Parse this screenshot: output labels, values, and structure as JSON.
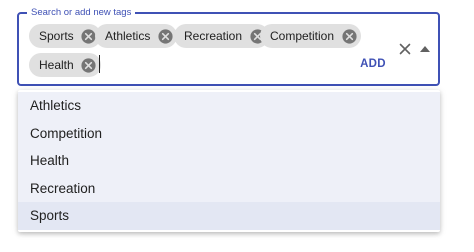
{
  "field": {
    "legend": "Search or add new tags",
    "add_label": "ADD",
    "accent_color": "#3f51b5"
  },
  "chips": [
    {
      "label": "Sports"
    },
    {
      "label": "Athletics"
    },
    {
      "label": "Recreation"
    },
    {
      "label": "Competition"
    },
    {
      "label": "Health"
    }
  ],
  "icons": {
    "chip_delete": "cancel-circle-icon",
    "clear": "close-icon",
    "toggle": "arrow-drop-up-icon"
  },
  "options": [
    {
      "label": "Athletics",
      "selected": false
    },
    {
      "label": "Competition",
      "selected": false
    },
    {
      "label": "Health",
      "selected": false
    },
    {
      "label": "Recreation",
      "selected": false
    },
    {
      "label": "Sports",
      "selected": true
    }
  ]
}
